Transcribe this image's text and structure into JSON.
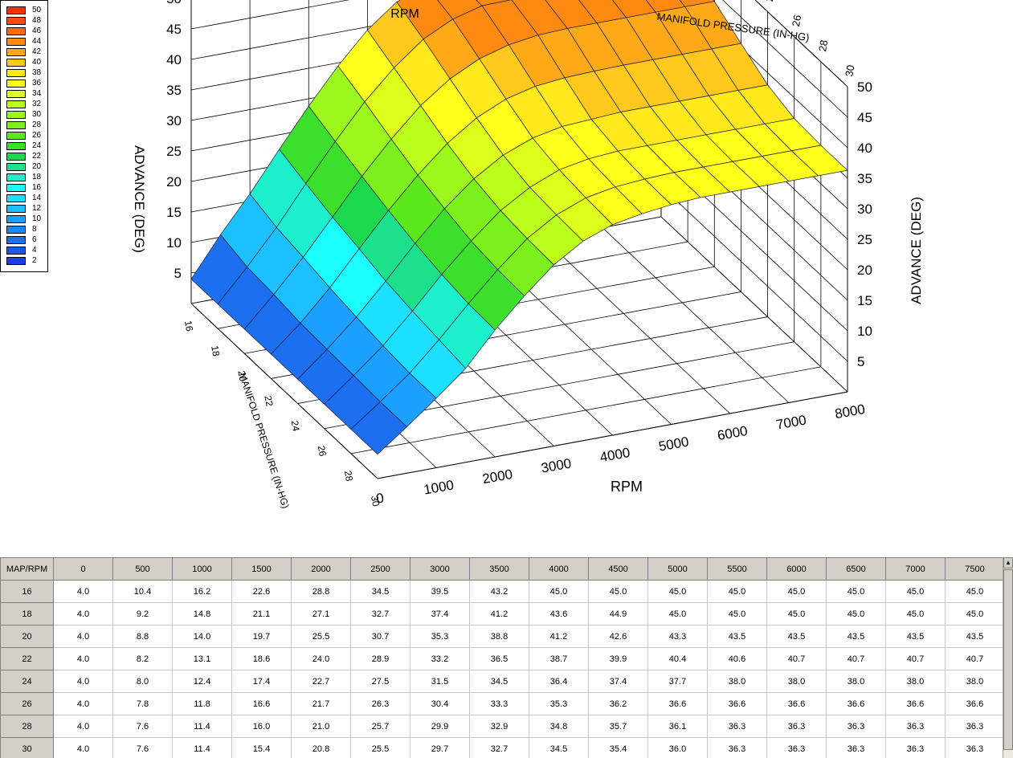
{
  "legend": {
    "items": [
      {
        "label": "50",
        "color": "#ff2e0c"
      },
      {
        "label": "48",
        "color": "#ff4a0c"
      },
      {
        "label": "46",
        "color": "#ff6a0c"
      },
      {
        "label": "44",
        "color": "#ff8a12"
      },
      {
        "label": "42",
        "color": "#ffa818"
      },
      {
        "label": "40",
        "color": "#ffc81c"
      },
      {
        "label": "38",
        "color": "#ffe81c"
      },
      {
        "label": "36",
        "color": "#ffff1c"
      },
      {
        "label": "34",
        "color": "#dcff1c"
      },
      {
        "label": "32",
        "color": "#bcff1c"
      },
      {
        "label": "30",
        "color": "#9cf81c"
      },
      {
        "label": "28",
        "color": "#7cf01c"
      },
      {
        "label": "26",
        "color": "#5ce81c"
      },
      {
        "label": "24",
        "color": "#3ce02c"
      },
      {
        "label": "22",
        "color": "#1cd84c"
      },
      {
        "label": "20",
        "color": "#1ce08c"
      },
      {
        "label": "18",
        "color": "#1cf0cc"
      },
      {
        "label": "16",
        "color": "#1cffff"
      },
      {
        "label": "14",
        "color": "#1ce0ff"
      },
      {
        "label": "12",
        "color": "#1cc0ff"
      },
      {
        "label": "10",
        "color": "#1ca0ff"
      },
      {
        "label": "8",
        "color": "#1c88f8"
      },
      {
        "label": "6",
        "color": "#1c70f0"
      },
      {
        "label": "4",
        "color": "#1c58e8"
      },
      {
        "label": "2",
        "color": "#1c40e0"
      }
    ]
  },
  "chart_data": {
    "type": "surface3d",
    "rpm": [
      0,
      500,
      1000,
      1500,
      2000,
      2500,
      3000,
      3500,
      4000,
      4500,
      5000,
      5500,
      6000,
      6500,
      7000,
      7500
    ],
    "map": [
      16,
      18,
      20,
      22,
      24,
      26,
      28,
      30
    ],
    "z": [
      [
        4.0,
        10.4,
        16.2,
        22.6,
        28.8,
        34.5,
        39.5,
        43.2,
        45.0,
        45.0,
        45.0,
        45.0,
        45.0,
        45.0,
        45.0,
        45.0
      ],
      [
        4.0,
        9.2,
        14.8,
        21.1,
        27.1,
        32.7,
        37.4,
        41.2,
        43.6,
        44.9,
        45.0,
        45.0,
        45.0,
        45.0,
        45.0,
        45.0
      ],
      [
        4.0,
        8.8,
        14.0,
        19.7,
        25.5,
        30.7,
        35.3,
        38.8,
        41.2,
        42.6,
        43.3,
        43.5,
        43.5,
        43.5,
        43.5,
        43.5
      ],
      [
        4.0,
        8.2,
        13.1,
        18.6,
        24.0,
        28.9,
        33.2,
        36.5,
        38.7,
        39.9,
        40.4,
        40.6,
        40.7,
        40.7,
        40.7,
        40.7
      ],
      [
        4.0,
        8.0,
        12.4,
        17.4,
        22.7,
        27.5,
        31.5,
        34.5,
        36.4,
        37.4,
        37.7,
        38.0,
        38.0,
        38.0,
        38.0,
        38.0
      ],
      [
        4.0,
        7.8,
        11.8,
        16.6,
        21.7,
        26.3,
        30.4,
        33.3,
        35.3,
        36.2,
        36.6,
        36.6,
        36.6,
        36.6,
        36.6,
        36.6
      ],
      [
        4.0,
        7.6,
        11.4,
        16.0,
        21.0,
        25.7,
        29.9,
        32.9,
        34.8,
        35.7,
        36.1,
        36.3,
        36.3,
        36.3,
        36.3,
        36.3
      ],
      [
        4.0,
        7.6,
        11.4,
        15.4,
        20.8,
        25.5,
        29.7,
        32.7,
        34.5,
        35.4,
        36.0,
        36.3,
        36.3,
        36.3,
        36.3,
        36.3
      ]
    ],
    "x_ticks": [
      "0",
      "1000",
      "2000",
      "3000",
      "4000",
      "5000",
      "6000",
      "7000",
      "8000"
    ],
    "y_ticks": [
      "16",
      "18",
      "20",
      "22",
      "24",
      "26",
      "28",
      "30"
    ],
    "z_ticks": [
      "5",
      "10",
      "15",
      "20",
      "25",
      "30",
      "35",
      "40",
      "45",
      "50"
    ],
    "xlabel": "RPM",
    "ylabel": "MANIFOLD PRESSURE (IN-HG)",
    "zlabel": "ADVANCE (DEG)",
    "xlim": [
      0,
      8000
    ],
    "ylim": [
      16,
      30
    ],
    "zlim": [
      0,
      50
    ]
  },
  "table": {
    "corner": "MAP/RPM",
    "headers": [
      "0",
      "500",
      "1000",
      "1500",
      "2000",
      "2500",
      "3000",
      "3500",
      "4000",
      "4500",
      "5000",
      "5500",
      "6000",
      "6500",
      "7000",
      "7500"
    ],
    "rows": [
      {
        "map": "16",
        "values": [
          "4.0",
          "10.4",
          "16.2",
          "22.6",
          "28.8",
          "34.5",
          "39.5",
          "43.2",
          "45.0",
          "45.0",
          "45.0",
          "45.0",
          "45.0",
          "45.0",
          "45.0",
          "45.0"
        ]
      },
      {
        "map": "18",
        "values": [
          "4.0",
          "9.2",
          "14.8",
          "21.1",
          "27.1",
          "32.7",
          "37.4",
          "41.2",
          "43.6",
          "44.9",
          "45.0",
          "45.0",
          "45.0",
          "45.0",
          "45.0",
          "45.0"
        ]
      },
      {
        "map": "20",
        "values": [
          "4.0",
          "8.8",
          "14.0",
          "19.7",
          "25.5",
          "30.7",
          "35.3",
          "38.8",
          "41.2",
          "42.6",
          "43.3",
          "43.5",
          "43.5",
          "43.5",
          "43.5",
          "43.5"
        ]
      },
      {
        "map": "22",
        "values": [
          "4.0",
          "8.2",
          "13.1",
          "18.6",
          "24.0",
          "28.9",
          "33.2",
          "36.5",
          "38.7",
          "39.9",
          "40.4",
          "40.6",
          "40.7",
          "40.7",
          "40.7",
          "40.7"
        ]
      },
      {
        "map": "24",
        "values": [
          "4.0",
          "8.0",
          "12.4",
          "17.4",
          "22.7",
          "27.5",
          "31.5",
          "34.5",
          "36.4",
          "37.4",
          "37.7",
          "38.0",
          "38.0",
          "38.0",
          "38.0",
          "38.0"
        ]
      },
      {
        "map": "26",
        "values": [
          "4.0",
          "7.8",
          "11.8",
          "16.6",
          "21.7",
          "26.3",
          "30.4",
          "33.3",
          "35.3",
          "36.2",
          "36.6",
          "36.6",
          "36.6",
          "36.6",
          "36.6",
          "36.6"
        ]
      },
      {
        "map": "28",
        "values": [
          "4.0",
          "7.6",
          "11.4",
          "16.0",
          "21.0",
          "25.7",
          "29.9",
          "32.9",
          "34.8",
          "35.7",
          "36.1",
          "36.3",
          "36.3",
          "36.3",
          "36.3",
          "36.3"
        ]
      },
      {
        "map": "30",
        "values": [
          "4.0",
          "7.6",
          "11.4",
          "15.4",
          "20.8",
          "25.5",
          "29.7",
          "32.7",
          "34.5",
          "35.4",
          "36.0",
          "36.3",
          "36.3",
          "36.3",
          "36.3",
          "36.3"
        ]
      }
    ]
  }
}
